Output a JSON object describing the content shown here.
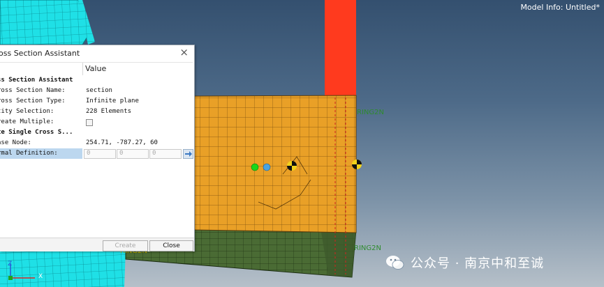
{
  "viewport": {
    "model_info": "Model Info: Untitled*",
    "labels": {
      "spring_top": "RING2N",
      "spring_bottom_right": "RING2N",
      "spring_bottom_left": "RING2N"
    },
    "axes": {
      "z": "Z",
      "x": "X"
    },
    "icons": [
      "node-marker-icon",
      "cross-section-marker-icon",
      "wechat-icon"
    ],
    "colors": {
      "plate": "#e9a027",
      "pillar": "#ff3a1e",
      "base": "#4a6b34",
      "mesh_cyan": "#1fe0e6",
      "node_green": "#19d719",
      "node_blue": "#4aa3e0"
    }
  },
  "watermark": {
    "text": "公众号 · 南京中和至诚"
  },
  "dialog": {
    "title": "oss Section Assistant",
    "close_symbol": "×",
    "column_header": "Value",
    "rows": [
      {
        "key": "ss Section Assistant",
        "type": "group"
      },
      {
        "key": "ross Section Name:",
        "value": "section"
      },
      {
        "key": "ross Section Type:",
        "value": "Infinite plane"
      },
      {
        "key": "tity Selection:",
        "value": "228 Elements"
      },
      {
        "key": "reate Multiple:",
        "value": "",
        "checkbox": true
      },
      {
        "key": "te Single Cross S...",
        "type": "group"
      },
      {
        "key": "ase Node:",
        "value": "254.71, -787.27, 60"
      },
      {
        "key": "rmal Definition:",
        "selected": true,
        "normal": [
          "0",
          "0",
          "0"
        ]
      }
    ],
    "buttons": {
      "create": "Create",
      "close": "Close"
    }
  }
}
